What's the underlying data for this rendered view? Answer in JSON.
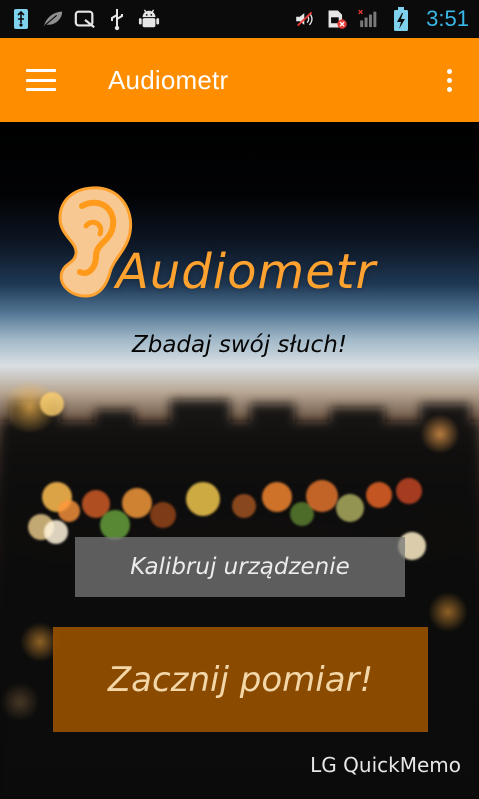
{
  "status_bar": {
    "time": "3:51",
    "icons": {
      "usb_debug": "usb-debug-icon",
      "leaf": "leaf-icon",
      "quickmemo": "quickmemo-icon",
      "usb": "usb-icon",
      "android_debug": "android-debug-icon",
      "mute": "volume-muted-icon",
      "sim_error": "sim-error-icon",
      "signal": "signal-icon",
      "battery": "battery-charging-icon"
    },
    "time_color": "#39b8e7"
  },
  "app_bar": {
    "title": "Audiometr",
    "color": "#fe8e00"
  },
  "hero": {
    "logo_text": "Audiometr",
    "tagline": "Zbadaj swój słuch!"
  },
  "actions": {
    "calibrate_label": "Kalibruj urządzenie",
    "start_label": "Zacznij pomiar!"
  },
  "watermark": "LG QuickMemo"
}
